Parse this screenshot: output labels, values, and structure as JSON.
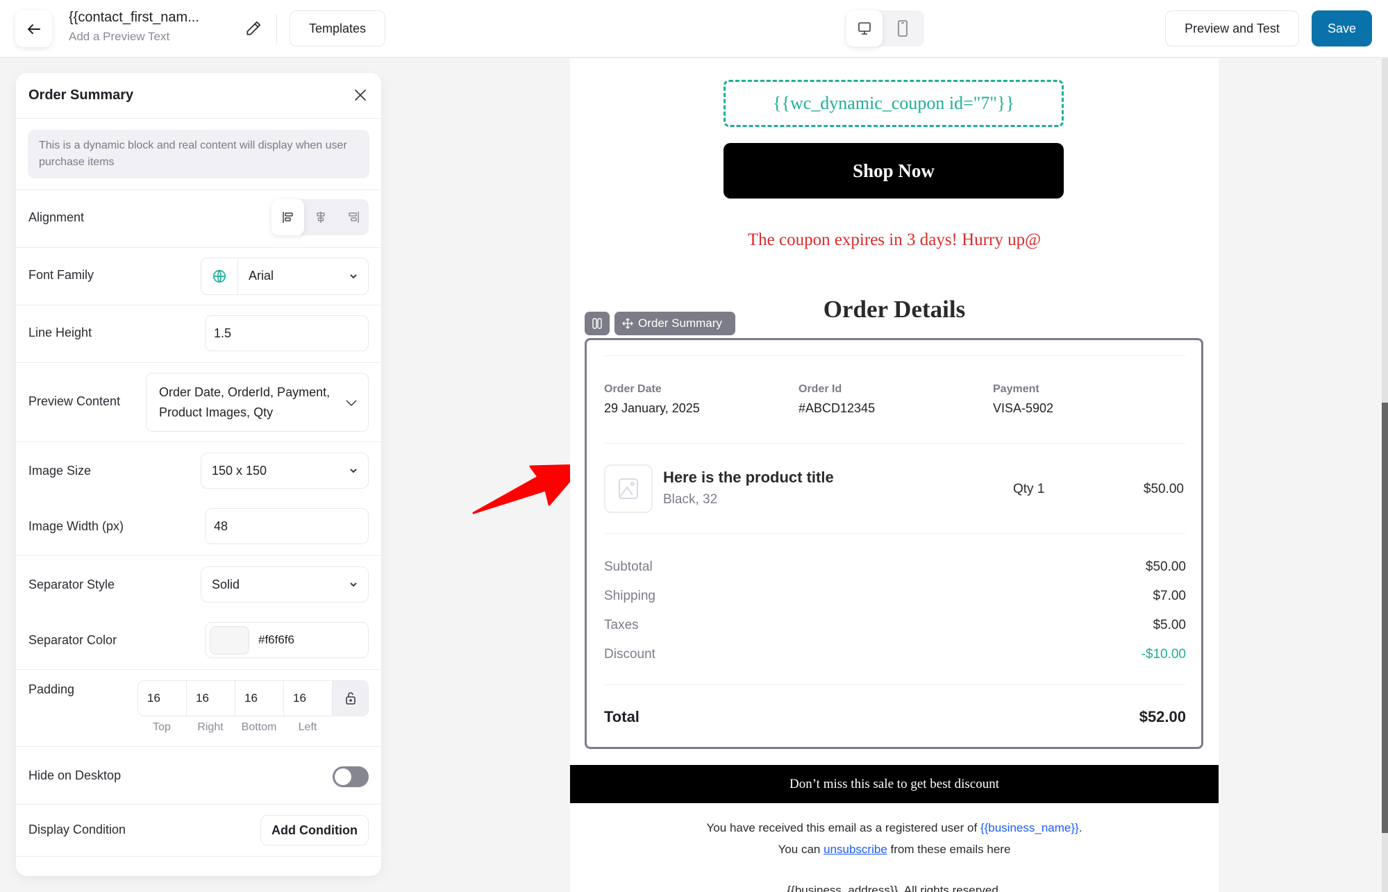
{
  "topbar": {
    "subject": "{{contact_first_nam...",
    "preview_text": "Add a Preview Text",
    "templates_label": "Templates",
    "preview_test_label": "Preview and Test",
    "save_label": "Save",
    "device_active": "desktop"
  },
  "panel": {
    "title": "Order Summary",
    "info": "This is a dynamic block and real content will display when user purchase items",
    "alignment_label": "Alignment",
    "alignment_value": "left",
    "font_family_label": "Font Family",
    "font_family_value": "Arial",
    "line_height_label": "Line Height",
    "line_height_value": "1.5",
    "preview_content_label": "Preview Content",
    "preview_content_value": "Order Date, OrderId, Payment, Product Images, Qty",
    "image_size_label": "Image Size",
    "image_size_value": "150 x 150",
    "image_width_label": "Image Width (px)",
    "image_width_value": "48",
    "separator_style_label": "Separator Style",
    "separator_style_value": "Solid",
    "separator_color_label": "Separator Color",
    "separator_color_value": "#f6f6f6",
    "padding_label": "Padding",
    "padding": {
      "top": "16",
      "right": "16",
      "bottom": "16",
      "left": "16"
    },
    "padding_side_labels": {
      "top": "Top",
      "right": "Right",
      "bottom": "Bottom",
      "left": "Left"
    },
    "hide_desktop_label": "Hide on Desktop",
    "hide_desktop_on": false,
    "display_condition_label": "Display Condition",
    "add_condition_label": "Add Condition"
  },
  "email": {
    "coupon": "{{wc_dynamic_coupon id=\"7\"}}",
    "shop_now": "Shop Now",
    "expire_text": "The coupon expires in 3 days! Hurry up@",
    "order_details_title": "Order Details",
    "block_tag": "Order Summary",
    "meta": [
      {
        "label": "Order Date",
        "value": "29 January, 2025"
      },
      {
        "label": "Order Id",
        "value": "#ABCD12345"
      },
      {
        "label": "Payment",
        "value": "VISA-5902"
      }
    ],
    "product": {
      "title": "Here is the product title",
      "variant": "Black, 32",
      "qty": "Qty 1",
      "price": "$50.00"
    },
    "totals": [
      {
        "label": "Subtotal",
        "value": "$50.00"
      },
      {
        "label": "Shipping",
        "value": "$7.00"
      },
      {
        "label": "Taxes",
        "value": "$5.00"
      },
      {
        "label": "Discount",
        "value": "-$10.00"
      }
    ],
    "total_label": "Total",
    "total_value": "$52.00",
    "promo": "Don’t miss this sale to get best discount",
    "footer_line1_pre": "You have received this email as a registered user of ",
    "footer_business": "{{business_name}}",
    "footer_line1_post": ".",
    "footer_line2_pre": "You can ",
    "footer_unsubscribe": "unsubscribe",
    "footer_line2_post": " from these emails here",
    "footer_line3": "{{business_address}}. All rights reserved."
  },
  "colors": {
    "accent": "#0a72ab",
    "coupon": "#1fae98",
    "expire": "#d92b2b",
    "link": "#1a5cff",
    "annotation_arrow": "#ff0000"
  }
}
